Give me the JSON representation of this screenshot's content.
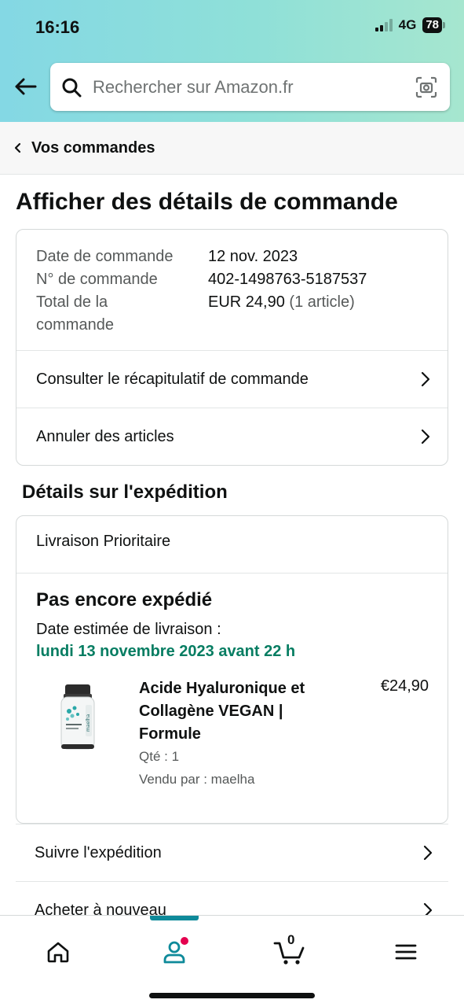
{
  "status_bar": {
    "time": "16:16",
    "network": "4G",
    "battery": "78"
  },
  "search": {
    "placeholder": "Rechercher sur Amazon.fr"
  },
  "breadcrumb": {
    "label": "Vos commandes"
  },
  "page_title": "Afficher des détails de commande",
  "order_summary": {
    "date_label": "Date de commande",
    "date_value": "12 nov. 2023",
    "number_label": "N° de commande",
    "number_value": "402-1498763-5187537",
    "total_label_line1": "Total de la",
    "total_label_line2": "commande",
    "total_value": "EUR 24,90",
    "total_items": "(1 article)",
    "links": [
      {
        "label": "Consulter le récapitulatif de commande"
      },
      {
        "label": "Annuler des articles"
      }
    ]
  },
  "shipment": {
    "section_title": "Détails sur l'expédition",
    "delivery_type": "Livraison Prioritaire",
    "status": "Pas encore expédié",
    "estimate_label": "Date estimée de livraison :",
    "estimate_date": "lundi 13 novembre 2023 avant 22 h",
    "item": {
      "name": "Acide Hyaluronique et Collagène VEGAN | Formule",
      "price": "€24,90",
      "quantity": "Qté : 1",
      "seller": "Vendu par : maelha",
      "image_brand": "maelha"
    }
  },
  "actions": [
    {
      "label": "Suivre l'expédition"
    },
    {
      "label": "Acheter à nouveau"
    }
  ],
  "tab_bar": {
    "cart_count": "0",
    "active_tab": "account"
  },
  "colors": {
    "accent_teal": "#0e8a9a",
    "delivery_green": "#067d62",
    "notification": "#e4004f"
  }
}
